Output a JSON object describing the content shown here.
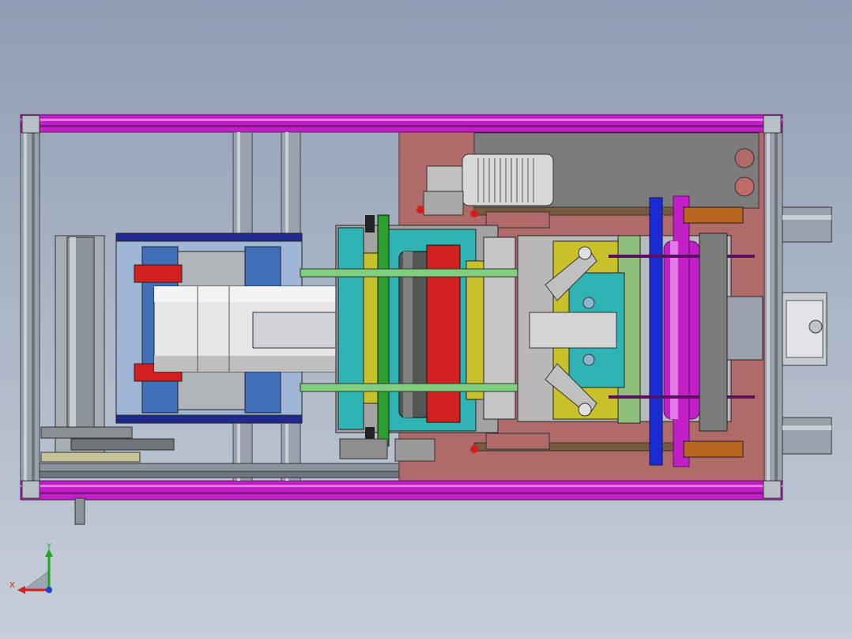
{
  "view": {
    "type": "cad-top-view",
    "colors": {
      "background_top": "#8f9db2",
      "background_bottom": "#c6ced9",
      "frame_rail": "#c21fc6",
      "frame_profile": "#9aa3ad",
      "base_plate": "#b06a6a",
      "motor": "#d8d8d8",
      "cylinder": "#e6e6e6",
      "mold_blue": "#3f6fb8",
      "mold_teal": "#2fb3b3",
      "accent_red": "#d21f1f",
      "accent_yellow": "#c9c12a",
      "accent_green": "#2ca02c",
      "roller_magenta": "#c21fc6",
      "roller_blue": "#1a2bd1"
    }
  },
  "triad": {
    "y_label": "Y",
    "x_label": "X",
    "y_color": "#1fa81f",
    "x_color": "#d22020",
    "z_color": "#2040d0"
  }
}
